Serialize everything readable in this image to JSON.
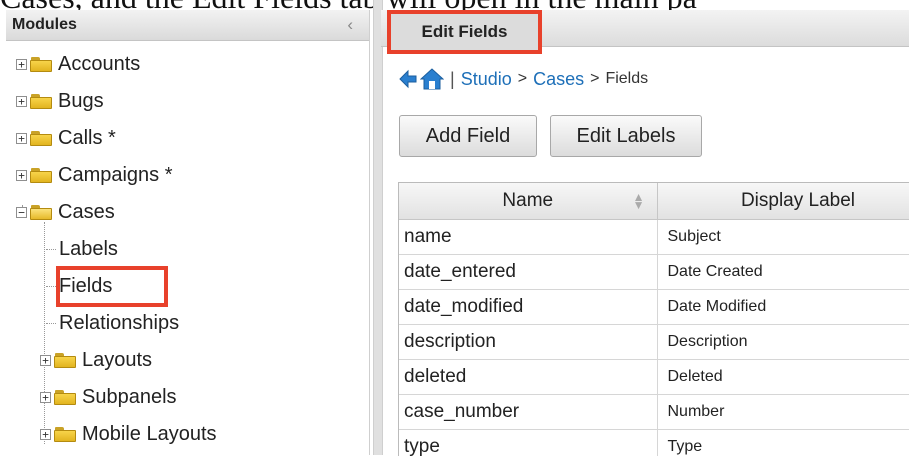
{
  "caption": {
    "text": "Cases, and the Edit Fields tab will open in the main pa"
  },
  "sidebar": {
    "title": "Modules",
    "items": [
      {
        "label": "Accounts"
      },
      {
        "label": "Bugs"
      },
      {
        "label": "Calls *"
      },
      {
        "label": "Campaigns *"
      },
      {
        "label": "Cases"
      },
      {
        "label": "Labels"
      },
      {
        "label": "Fields"
      },
      {
        "label": "Relationships"
      },
      {
        "label": "Layouts"
      },
      {
        "label": "Subpanels"
      },
      {
        "label": "Mobile Layouts"
      }
    ]
  },
  "main": {
    "tab_label": "Edit Fields",
    "breadcrumb": {
      "separator": "|",
      "studio": "Studio",
      "arrow1": ">",
      "cases": "Cases",
      "arrow2": ">",
      "fields": "Fields"
    },
    "buttons": {
      "add_field": "Add Field",
      "edit_labels": "Edit Labels"
    },
    "table": {
      "columns": [
        "Name",
        "Display Label"
      ],
      "rows": [
        {
          "name": "name",
          "label": "Subject"
        },
        {
          "name": "date_entered",
          "label": "Date Created"
        },
        {
          "name": "date_modified",
          "label": "Date Modified"
        },
        {
          "name": "description",
          "label": "Description"
        },
        {
          "name": "deleted",
          "label": "Deleted"
        },
        {
          "name": "case_number",
          "label": "Number"
        },
        {
          "name": "type",
          "label": "Type"
        }
      ]
    }
  },
  "icons": {
    "collapse": "chevron-left-icon",
    "back": "back-arrow-icon",
    "home": "home-icon",
    "sort": "sort-icon",
    "folder": "folder-icon"
  },
  "colors": {
    "highlight": "#e8412b",
    "link": "#1d6fb8",
    "folder": "#f2c93a"
  }
}
